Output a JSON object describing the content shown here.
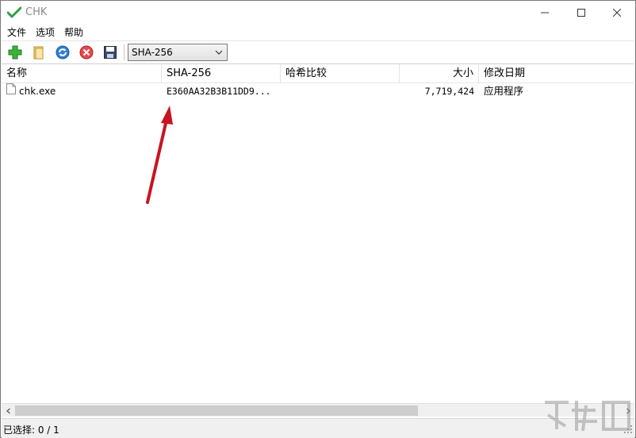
{
  "window": {
    "title": "CHK",
    "icon": "check-icon",
    "controls": [
      "minimize-icon",
      "maximize-icon",
      "close-icon"
    ]
  },
  "menu": {
    "items": [
      {
        "label": "文件"
      },
      {
        "label": "选项"
      },
      {
        "label": "帮助"
      }
    ]
  },
  "toolbar": {
    "buttons": [
      "add-icon",
      "open-folder-icon",
      "refresh-icon",
      "stop-icon",
      "save-icon"
    ],
    "algorithm": {
      "selected": "SHA-256"
    }
  },
  "list": {
    "columns": {
      "name": "名称",
      "hash": "SHA-256",
      "compare": "哈希比较",
      "size": "大小",
      "date": "修改日期"
    },
    "rows": [
      {
        "name": "chk.exe",
        "hash": "E360AA32B3B11DD9...",
        "compare": "",
        "size": "7,719,424",
        "date": "应用程序"
      }
    ]
  },
  "status": {
    "text": "已选择: 0 / 1"
  },
  "colors": {
    "arrow": "#c8141e",
    "check": "#2ea043",
    "title_text": "#8a8a8a"
  }
}
